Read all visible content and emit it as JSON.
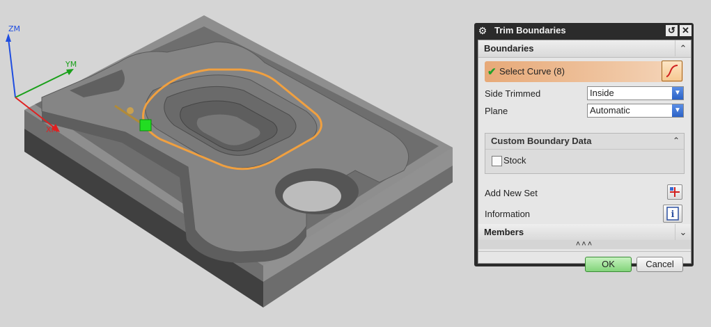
{
  "viewport": {
    "axes": {
      "z_label": "ZM",
      "y_label": "YM",
      "x_label": "XM"
    },
    "colors": {
      "z_axis": "#1f4de0",
      "y_axis": "#1aa01a",
      "x_axis": "#e02020",
      "boundary": "#f0a040",
      "part": "#7a7a7a",
      "background": "#d5d5d5"
    }
  },
  "dialog": {
    "title": "Trim Boundaries",
    "icons": {
      "settings": "gear-icon",
      "reset": "reset-icon",
      "close": "close-icon"
    },
    "boundaries": {
      "header": "Boundaries",
      "select_curve_label": "Select Curve (8)",
      "side_trimmed_label": "Side Trimmed",
      "side_trimmed_value": "Inside",
      "plane_label": "Plane",
      "plane_value": "Automatic",
      "custom_boundary": {
        "header": "Custom Boundary Data",
        "stock_label": "Stock",
        "stock_checked": false
      },
      "add_new_set_label": "Add New Set",
      "information_label": "Information"
    },
    "members": {
      "header": "Members"
    },
    "more_indicator": "˄˄˄",
    "buttons": {
      "ok": "OK",
      "cancel": "Cancel"
    }
  }
}
